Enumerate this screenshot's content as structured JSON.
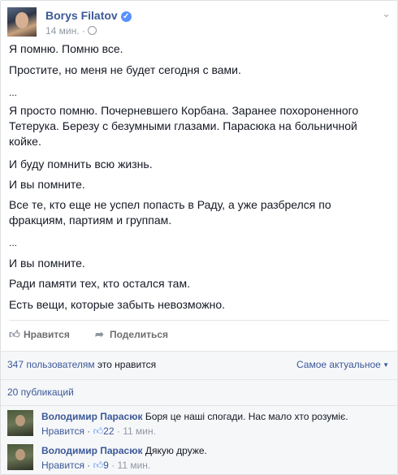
{
  "post": {
    "author": "Borys Filatov",
    "time": "14 мин. ·",
    "paragraphs": [
      "Я помню. Помню все.",
      "Простите, но меня не будет сегодня с вами.",
      "...",
      "Я просто помню. Почерневшего Корбана. Заранее похороненного Тетерука. Березу с безумными глазами. Парасюка на больничной койке.",
      "И буду помнить всю жизнь.",
      "И вы помните.",
      "Все те, кто еще не успел попасть в Раду, а уже разбрелся по фракциям, партиям и группам.",
      "...",
      "И вы помните.",
      "Ради памяти тех, кто остался там.",
      "Есть вещи, которые забыть невозможно."
    ]
  },
  "actions": {
    "like": "Нравится",
    "share": "Поделиться"
  },
  "social": {
    "likes_count": "347 пользователям",
    "likes_suffix": "это нравится",
    "sort_label": "Самое актуальное",
    "shares": "20 публикаций"
  },
  "comments": [
    {
      "author": "Володимир Парасюк",
      "text": "Боря це наші спогади. Нас мало хто розуміє.",
      "like_label": "Нравится ·",
      "likes": "22",
      "time": "· 11 мин."
    },
    {
      "author": "Володимир Парасюк",
      "text": "Дякую друже.",
      "like_label": "Нравится ·",
      "likes": "9",
      "time": "· 11 мин."
    }
  ],
  "icons": {
    "verified": "verified-badge-icon",
    "chevron": "chevron-down-icon",
    "like": "thumbs-up-icon",
    "share": "share-arrow-icon"
  },
  "colors": {
    "link": "#3b5998",
    "text": "#141823",
    "muted": "#9197a3",
    "footer_bg": "#f6f7f9"
  }
}
